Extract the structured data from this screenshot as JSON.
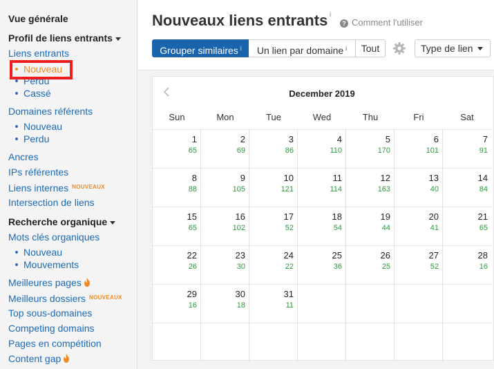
{
  "sidebar": {
    "overview": "Vue générale",
    "backlinks_profile": "Profil de liens entrants",
    "backlinks": "Liens entrants",
    "backlinks_sub": [
      "Nouveau",
      "Perdu",
      "Cassé"
    ],
    "referring_domains": "Domaines référents",
    "referring_sub": [
      "Nouveau",
      "Perdu"
    ],
    "anchors": "Ancres",
    "referring_ips": "IPs référentes",
    "internal_links": "Liens internes",
    "internal_badge": "NOUVEAUX",
    "link_intersect": "Intersection de liens",
    "organic_search": "Recherche organique",
    "organic_keywords": "Mots clés organiques",
    "organic_sub": [
      "Nouveau",
      "Mouvements"
    ],
    "top_pages": "Meilleures pages",
    "top_folders": "Meilleurs dossiers",
    "top_folders_badge": "NOUVEAUX",
    "top_subdomains": "Top sous-domaines",
    "competing_domains": "Competing domains",
    "competing_pages": "Pages en compétition",
    "content_gap": "Content gap"
  },
  "header": {
    "title": "Nouveaux liens entrants",
    "title_info": "i",
    "help_icon": "?",
    "help": "Comment l'utiliser"
  },
  "toolbar": {
    "group_similar": "Grouper similaires",
    "group_info": "i",
    "one_per_domain": "Un lien par domaine",
    "domain_info": "i",
    "all": "Tout",
    "link_type": "Type de lien"
  },
  "calendar": {
    "month": "December 2019",
    "weekdays": [
      "Sun",
      "Mon",
      "Tue",
      "Wed",
      "Thu",
      "Fri",
      "Sat"
    ],
    "weeks": [
      [
        {
          "day": "1",
          "count": "65"
        },
        {
          "day": "2",
          "count": "69"
        },
        {
          "day": "3",
          "count": "86"
        },
        {
          "day": "4",
          "count": "110"
        },
        {
          "day": "5",
          "count": "170"
        },
        {
          "day": "6",
          "count": "101"
        },
        {
          "day": "7",
          "count": "91"
        }
      ],
      [
        {
          "day": "8",
          "count": "88"
        },
        {
          "day": "9",
          "count": "105"
        },
        {
          "day": "10",
          "count": "121"
        },
        {
          "day": "11",
          "count": "114"
        },
        {
          "day": "12",
          "count": "163"
        },
        {
          "day": "13",
          "count": "40"
        },
        {
          "day": "14",
          "count": "84"
        }
      ],
      [
        {
          "day": "15",
          "count": "65"
        },
        {
          "day": "16",
          "count": "102"
        },
        {
          "day": "17",
          "count": "52"
        },
        {
          "day": "18",
          "count": "54"
        },
        {
          "day": "19",
          "count": "44"
        },
        {
          "day": "20",
          "count": "41"
        },
        {
          "day": "21",
          "count": "65"
        }
      ],
      [
        {
          "day": "22",
          "count": "26"
        },
        {
          "day": "23",
          "count": "30"
        },
        {
          "day": "24",
          "count": "22"
        },
        {
          "day": "25",
          "count": "36"
        },
        {
          "day": "26",
          "count": "25"
        },
        {
          "day": "27",
          "count": "52"
        },
        {
          "day": "28",
          "count": "16"
        }
      ],
      [
        {
          "day": "29",
          "count": "16"
        },
        {
          "day": "30",
          "count": "18"
        },
        {
          "day": "31",
          "count": "11"
        },
        null,
        null,
        null,
        null
      ],
      [
        null,
        null,
        null,
        null,
        null,
        null,
        null
      ]
    ]
  },
  "colors": {
    "link": "#1a6ab8",
    "active_item": "#f08a24",
    "primary_button": "#1a63ad",
    "count_green": "#2a9a3b",
    "highlight_box": "#ee1c1c"
  },
  "icons": {
    "fire": "fire-icon",
    "gear": "gear-icon",
    "help": "question-circle-icon",
    "prev": "chevron-left-icon"
  }
}
